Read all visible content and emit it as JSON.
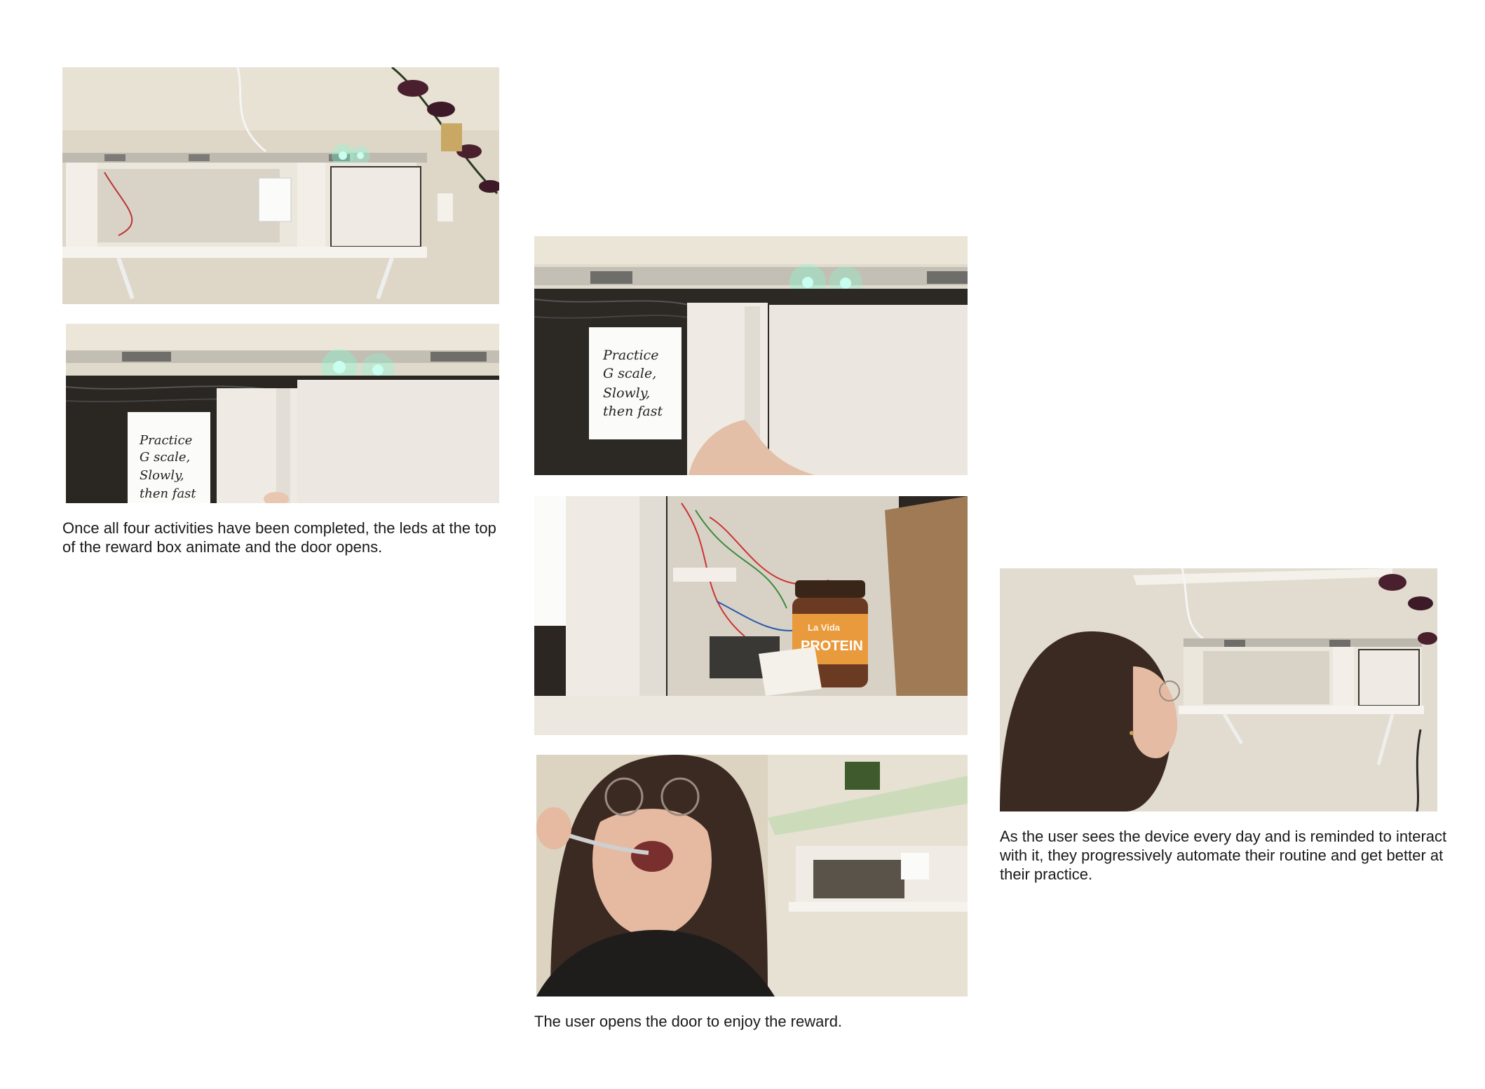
{
  "captions": {
    "leds": "Once all four activities have been completed, the leds at the top of the reward box animate and the door opens.",
    "reward": "The user opens the door to enjoy the reward.",
    "routine": "As the user sees the device every day and is reminded to interact with it, they progressively automate their routine and get better at their practice."
  },
  "note": {
    "line1": "Practice",
    "line2": "G scale,",
    "line3": "Slowly,",
    "line4": "then fast"
  },
  "jar": {
    "brand": "La Vida",
    "label": "PROTEIN"
  },
  "colors": {
    "background": "#ffffff",
    "caption_text": "#1a1a1a",
    "led_glow": "#7fffd4",
    "wall": "#e2ddd0",
    "wood_box": "#f1ede6",
    "jar_label": "#e89a3c"
  }
}
